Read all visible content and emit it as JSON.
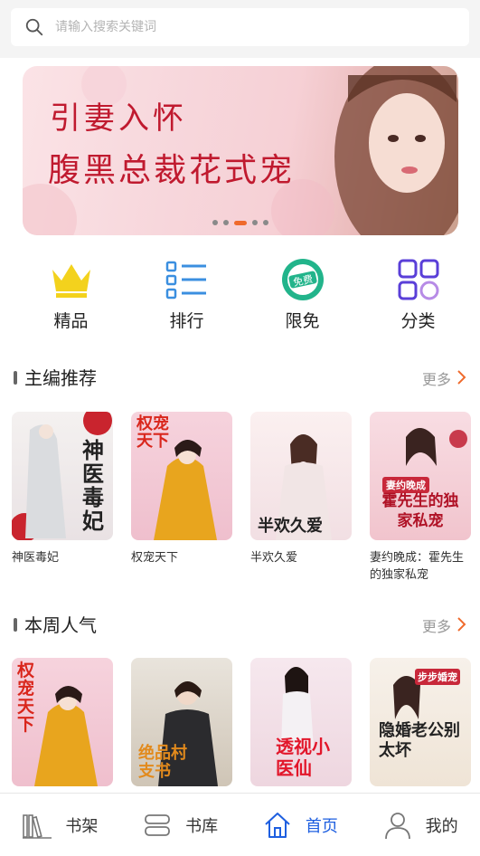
{
  "search": {
    "placeholder": "请输入搜索关键词"
  },
  "banner": {
    "line1": "引妻入怀",
    "line2": "腹黑总裁花式宠",
    "dots": 5,
    "active_dot": 2
  },
  "quick_nav": [
    {
      "label": "精品",
      "icon": "crown-icon",
      "color": "#f3d21d"
    },
    {
      "label": "排行",
      "icon": "list-icon",
      "color": "#3b8fe0"
    },
    {
      "label": "限免",
      "icon": "free-badge-icon",
      "color": "#22b48b"
    },
    {
      "label": "分类",
      "icon": "category-grid-icon",
      "color": "#5a3fd8"
    }
  ],
  "sections": [
    {
      "title": "主编推荐",
      "more": "更多",
      "books": [
        {
          "name": "神医毒妃",
          "cover_text": "神医毒妃"
        },
        {
          "name": "权宠天下",
          "cover_text": "权宠天下"
        },
        {
          "name": "半欢久爱",
          "cover_text": "半欢久爱"
        },
        {
          "name": "妻约晚成：霍先生的独家私宠",
          "cover_text": "霍先生的独家私宠",
          "cover_sub": "妻约晚成"
        }
      ]
    },
    {
      "title": "本周人气",
      "more": "更多",
      "books": [
        {
          "name": "",
          "cover_text": "权宠天下"
        },
        {
          "name": "",
          "cover_text": "绝品村支书"
        },
        {
          "name": "",
          "cover_text": "透视小医仙"
        },
        {
          "name": "",
          "cover_text": "隐婚老公别太坏",
          "cover_sub": "步步婚宠"
        }
      ]
    }
  ],
  "tabbar": [
    {
      "label": "书架",
      "icon": "bookshelf-icon",
      "active": false
    },
    {
      "label": "书库",
      "icon": "library-icon",
      "active": false
    },
    {
      "label": "首页",
      "icon": "home-icon",
      "active": true
    },
    {
      "label": "我的",
      "icon": "user-icon",
      "active": false
    }
  ],
  "colors": {
    "accent": "#1e5fe0",
    "banner_text": "#c01a2f",
    "more_arrow": "#ef6a2c"
  }
}
